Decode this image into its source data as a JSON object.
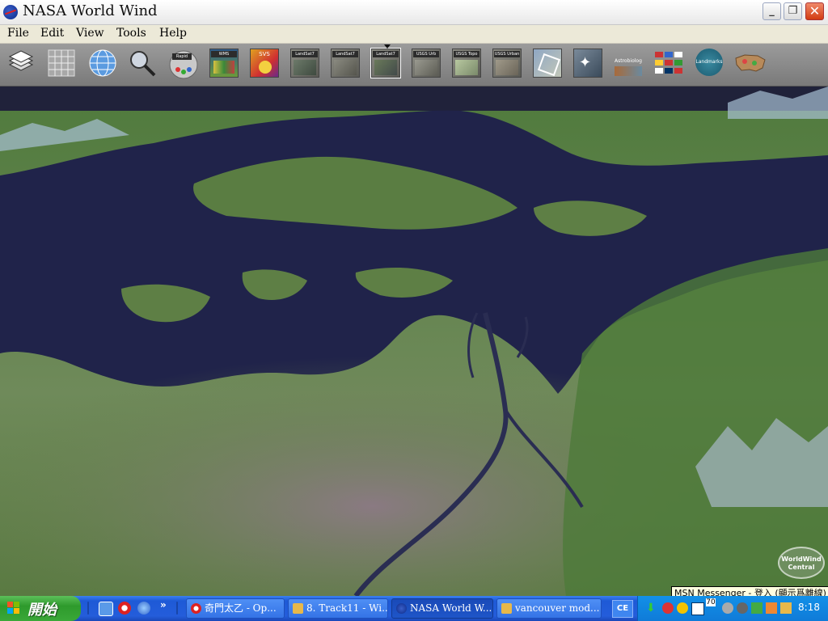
{
  "window": {
    "title": "NASA World Wind",
    "minimize_glyph": "_",
    "maximize_glyph": "❐",
    "close_glyph": "✕"
  },
  "menu": {
    "items": [
      {
        "label": "File"
      },
      {
        "label": "Edit"
      },
      {
        "label": "View"
      },
      {
        "label": "Tools"
      },
      {
        "label": "Help"
      }
    ]
  },
  "toolbar": {
    "tools": [
      {
        "name": "layers-icon",
        "label": ""
      },
      {
        "name": "grid-icon",
        "label": ""
      },
      {
        "name": "globe-icon",
        "label": ""
      },
      {
        "name": "magnifier-icon",
        "label": ""
      },
      {
        "name": "modis-icon",
        "label": "Rapid Fire MODIS"
      },
      {
        "name": "wms-icon",
        "label": "WMS"
      },
      {
        "name": "svs-icon",
        "label": "SVS"
      },
      {
        "name": "landsat-visible-icon",
        "label": "LandSat7 Visible"
      },
      {
        "name": "landsat-visible-wms-icon",
        "label": "LandSat7 Visible"
      },
      {
        "name": "landsat-pseudo-icon",
        "label": "LandSat7 Pseudo"
      },
      {
        "name": "usgs-urban-ortho-icon",
        "label": "USGS Urb Ortho"
      },
      {
        "name": "usgs-topo-map-icon",
        "label": "USGS Topo Map"
      },
      {
        "name": "usgs-urban-area-icon",
        "label": "USGS Urban Area"
      },
      {
        "name": "map-overlay-icon",
        "label": ""
      },
      {
        "name": "stars-icon",
        "label": ""
      },
      {
        "name": "astrobiology-icon",
        "label": "Astrobiology"
      },
      {
        "name": "flags-icon",
        "label": ""
      },
      {
        "name": "landmarks-icon",
        "label": "Landmarks"
      },
      {
        "name": "usa-map-icon",
        "label": ""
      }
    ]
  },
  "map": {
    "logo_text": "WorldWind Central",
    "tooltip": "MSN Messenger - 登入 (顯示爲離線)"
  },
  "taskbar": {
    "start_label": "開始",
    "quick_launch_chevron": "»",
    "tasks": [
      {
        "label": "奇門太乙 - Op..."
      },
      {
        "label": "8. Track11 - Wi..."
      },
      {
        "label": "NASA World W..."
      },
      {
        "label": "vancouver mod..."
      }
    ],
    "language": "CE",
    "tray_value": "70",
    "clock": "8:18"
  }
}
